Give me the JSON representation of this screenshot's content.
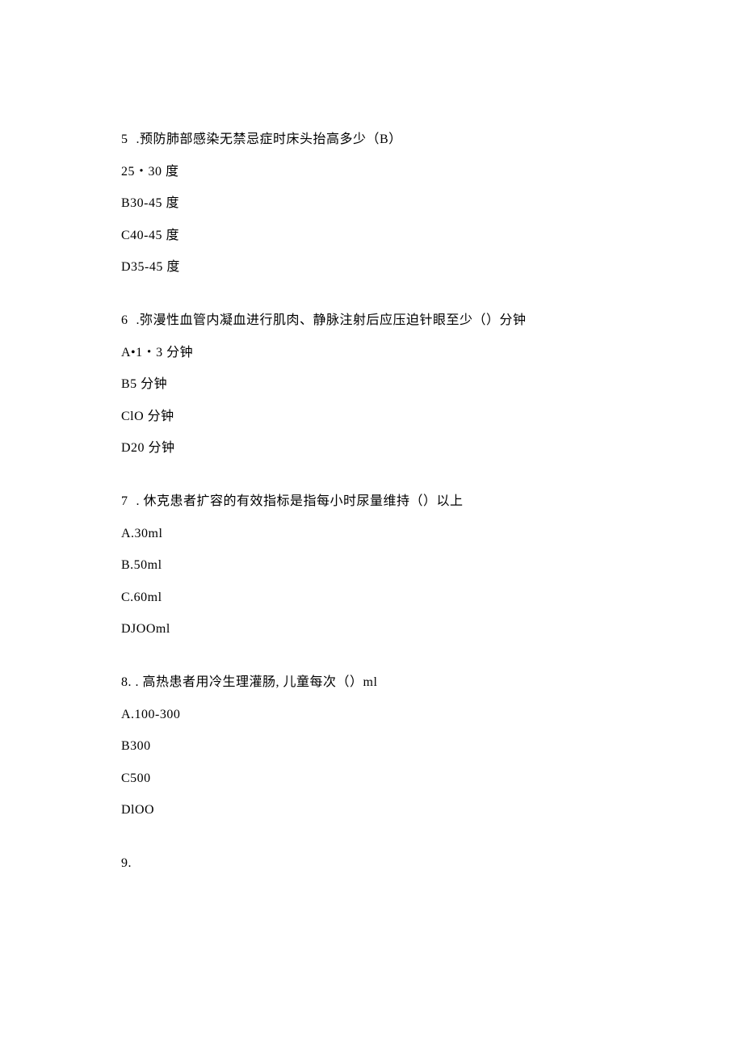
{
  "questions": [
    {
      "number": "5",
      "sep": " .",
      "text": "预防肺部感染无禁忌症时床头抬高多少（B）",
      "options": [
        "25・30 度",
        "B30-45 度",
        "C40-45 度",
        "D35-45 度"
      ]
    },
    {
      "number": "6",
      "sep": " .",
      "text": "弥漫性血管内凝血进行肌肉、静脉注射后应压迫针眼至少（）分钟",
      "options": [
        "A•1・3 分钟",
        "B5 分钟",
        "ClO 分钟",
        "D20 分钟"
      ]
    },
    {
      "number": "7",
      "sep": " . ",
      "text": "休克患者扩容的有效指标是指每小时尿量维持（）以上",
      "options": [
        "A.30ml",
        "B.50ml",
        "C.60ml",
        "DJOOml"
      ]
    },
    {
      "number": "8. . ",
      "sep": "",
      "text": "高热患者用冷生理灌肠, 儿童每次（）ml",
      "options": [
        "A.100-300",
        "B300",
        "C500",
        "DlOO"
      ]
    },
    {
      "number": "9.",
      "sep": "",
      "text": "",
      "options": []
    }
  ]
}
